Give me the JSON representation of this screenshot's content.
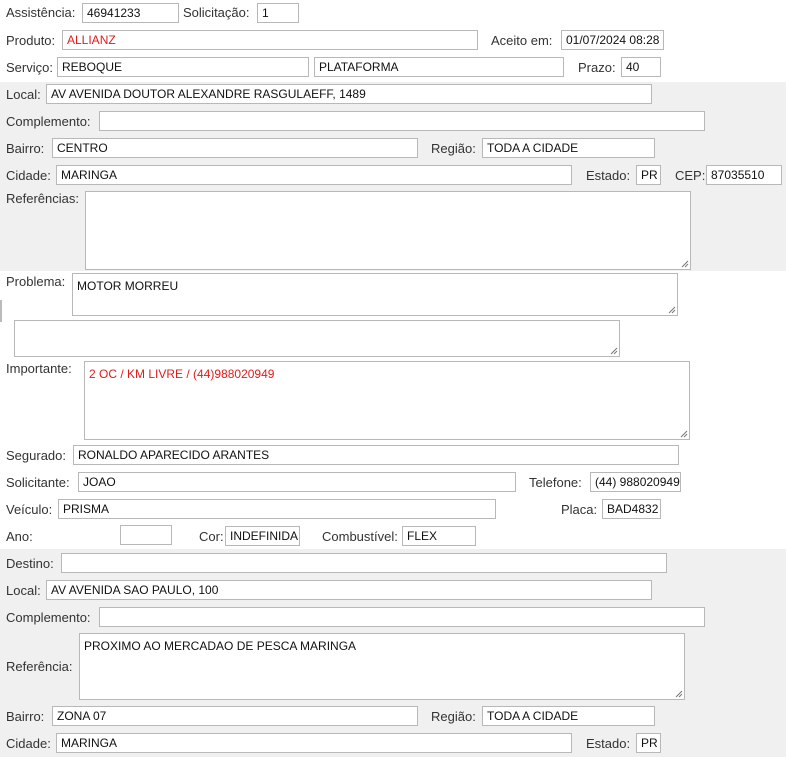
{
  "assistencia": {
    "label": "Assistência:",
    "value": "46941233"
  },
  "solicitacao": {
    "label": "Solicitação:",
    "value": "1"
  },
  "produto": {
    "label": "Produto:",
    "value": "ALLIANZ",
    "value_color": "#e31b1b"
  },
  "aceito_em": {
    "label": "Aceito em:",
    "value": "01/07/2024 08:28"
  },
  "servico": {
    "label": "Serviço:",
    "value1": "REBOQUE",
    "value2": "PLATAFORMA"
  },
  "prazo": {
    "label": "Prazo:",
    "value": "40"
  },
  "origem": {
    "local": {
      "label": "Local:",
      "value": "AV AVENIDA DOUTOR ALEXANDRE RASGULAEFF, 1489"
    },
    "complemento": {
      "label": "Complemento:",
      "value": ""
    },
    "bairro": {
      "label": "Bairro:",
      "value": "CENTRO"
    },
    "regiao": {
      "label": "Região:",
      "value": "TODA A CIDADE"
    },
    "cidade": {
      "label": "Cidade:",
      "value": "MARINGA"
    },
    "estado": {
      "label": "Estado:",
      "value": "PR"
    },
    "cep": {
      "label": "CEP:",
      "value": "87035510"
    },
    "referencias": {
      "label": "Referências:",
      "value": ""
    }
  },
  "problema": {
    "label": "Problema:",
    "value": "MOTOR MORREU",
    "extra": ""
  },
  "importante": {
    "label": "Importante:",
    "value": "2 OC / KM LIVRE / (44)988020949",
    "value_color": "#e31b1b"
  },
  "segurado": {
    "label": "Segurado:",
    "value": "RONALDO APARECIDO ARANTES"
  },
  "solicitante": {
    "label": "Solicitante:",
    "value": "JOAO"
  },
  "telefone": {
    "label": "Telefone:",
    "value": "(44) 988020949"
  },
  "veiculo": {
    "label": "Veículo:",
    "value": "PRISMA"
  },
  "placa": {
    "label": "Placa:",
    "value": "BAD4832"
  },
  "ano": {
    "label": "Ano:",
    "value": ""
  },
  "cor": {
    "label": "Cor:",
    "value": "INDEFINIDA"
  },
  "combustivel": {
    "label": "Combustível:",
    "value": "FLEX"
  },
  "destino": {
    "destino": {
      "label": "Destino:",
      "value": ""
    },
    "local": {
      "label": "Local:",
      "value": "AV AVENIDA SAO PAULO, 100"
    },
    "complemento": {
      "label": "Complemento:",
      "value": ""
    },
    "referencia": {
      "label": "Referência:",
      "value": "PROXIMO AO MERCADAO DE PESCA MARINGA"
    },
    "bairro": {
      "label": "Bairro:",
      "value": "ZONA 07"
    },
    "regiao": {
      "label": "Região:",
      "value": "TODA A CIDADE"
    },
    "cidade": {
      "label": "Cidade:",
      "value": "MARINGA"
    },
    "estado": {
      "label": "Estado:",
      "value": "PR"
    }
  }
}
